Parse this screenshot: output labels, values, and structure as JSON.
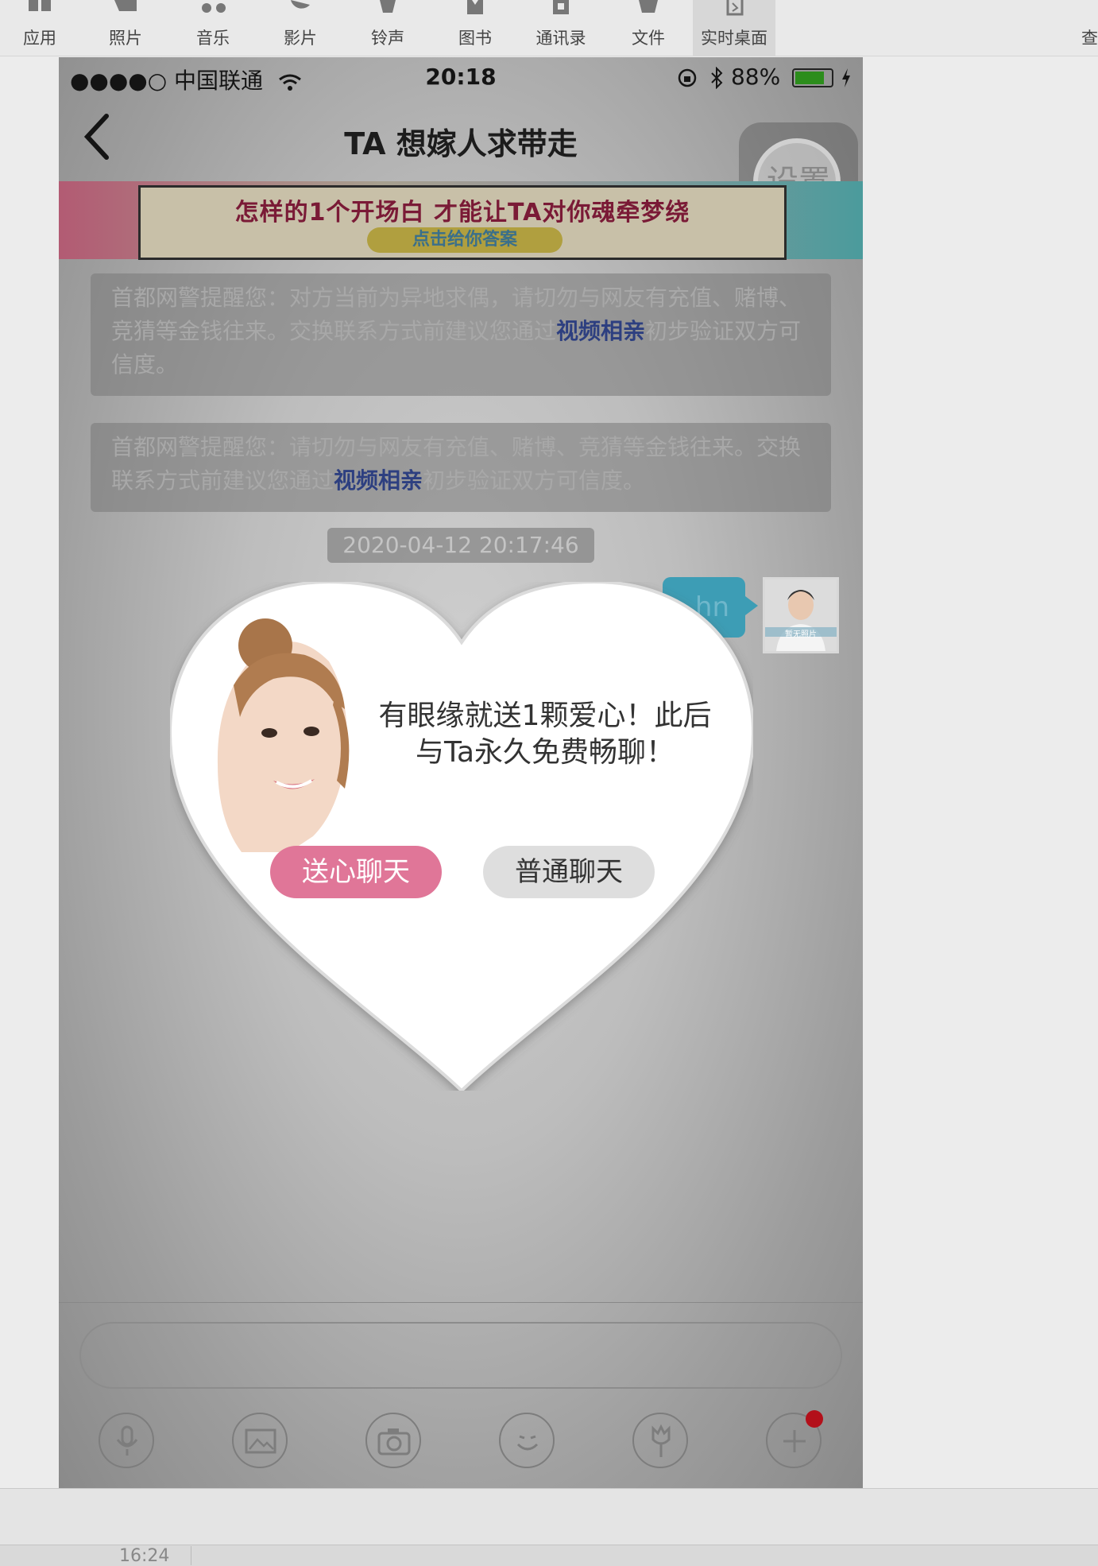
{
  "toolbar": {
    "items": [
      {
        "label": "应用",
        "icon": "apps-icon"
      },
      {
        "label": "照片",
        "icon": "photos-icon"
      },
      {
        "label": "音乐",
        "icon": "music-icon"
      },
      {
        "label": "影片",
        "icon": "movies-icon"
      },
      {
        "label": "铃声",
        "icon": "bell-icon"
      },
      {
        "label": "图书",
        "icon": "books-icon"
      },
      {
        "label": "通讯录",
        "icon": "contacts-icon"
      },
      {
        "label": "文件",
        "icon": "files-icon"
      },
      {
        "label": "实时桌面",
        "icon": "live-desktop-icon"
      }
    ],
    "active_index": 8,
    "edge_char": "查"
  },
  "statusbar": {
    "carrier": "●●●●○ 中国联通",
    "time": "20:18",
    "battery": "88%"
  },
  "navbar": {
    "title": "TA  想嫁人求带走",
    "settings_label": "设置"
  },
  "banner": {
    "title": "怎样的1个开场白 才能让TA对你魂牵梦绕",
    "button": "点击给你答案"
  },
  "warnings": [
    {
      "before": "首都网警提醒您：对方当前为异地求偶，请切勿与网友有充值、赌博、竞猜等金钱往来。交换联系方式前建议您通过",
      "link": "视频相亲",
      "after": "初步验证双方可信度。"
    },
    {
      "before": "首都网警提醒您：请切勿与网友有充值、赌博、竞猜等金钱往来。交换联系方式前建议您通过",
      "link": "视频相亲",
      "after": "初步验证双方可信度。"
    }
  ],
  "chat": {
    "timestamp": "2020-04-12 20:17:46",
    "bubble_text": "hn",
    "avatar_caption": "暂无照片"
  },
  "modal": {
    "message": "有眼缘就送1颗爱心！此后与Ta永久免费畅聊！",
    "send_button": "送心聊天",
    "normal_button": "普通聊天"
  },
  "input": {
    "placeholder": ""
  },
  "footer": {
    "time": "16:24"
  },
  "colors": {
    "accent_pink": "#e07698",
    "bubble_blue": "#3d9db5",
    "link_blue": "#2d3f80"
  }
}
